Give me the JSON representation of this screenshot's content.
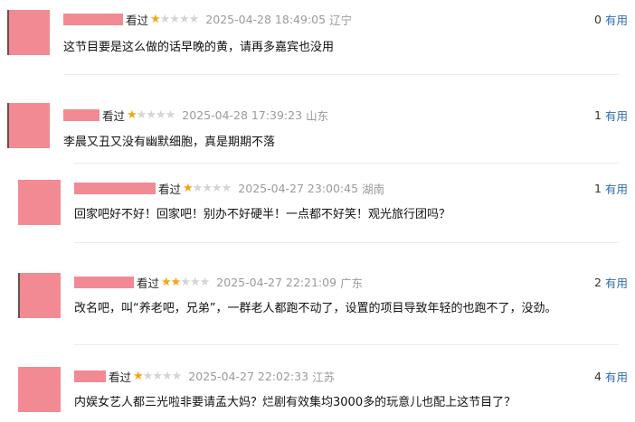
{
  "comments": [
    {
      "user_fragment": "",
      "watched_label": "看过",
      "stars": 1,
      "time": "2025-04-28 18:49:05",
      "region": "辽宁",
      "useful_count": "0",
      "useful_label": "有用",
      "text": "这节目要是这么做的话早晚的黄，请再多嘉宾也没用"
    },
    {
      "user_fragment": "",
      "watched_label": "看过",
      "stars": 1,
      "time": "2025-04-28 17:39:23",
      "region": "山东",
      "useful_count": "1",
      "useful_label": "有用",
      "text": "李晨又丑又没有幽默细胞，真是期期不落"
    },
    {
      "user_fragment": "",
      "watched_label": "看过",
      "stars": 1,
      "time": "2025-04-27 23:00:45",
      "region": "湖南",
      "useful_count": "1",
      "useful_label": "有用",
      "text": "回家吧好不好！回家吧！别办不好硬半！一点都不好笑！观光旅行团吗？"
    },
    {
      "user_fragment": "",
      "watched_label": "看过",
      "stars": 2,
      "time": "2025-04-27 22:21:09",
      "region": "广东",
      "useful_count": "2",
      "useful_label": "有用",
      "text": "改名吧，叫“养老吧，兄弟”，一群老人都跑不动了，设置的项目导致年轻的也跑不了，没劲。"
    },
    {
      "user_fragment": "",
      "watched_label": "看过",
      "stars": 1,
      "time": "2025-04-27 22:02:33",
      "region": "江苏",
      "useful_count": "4",
      "useful_label": "有用",
      "text": "内娱女艺人都三光啦非要请孟大妈？烂剧有效集均3000多的玩意儿也配上这节目了？"
    }
  ]
}
